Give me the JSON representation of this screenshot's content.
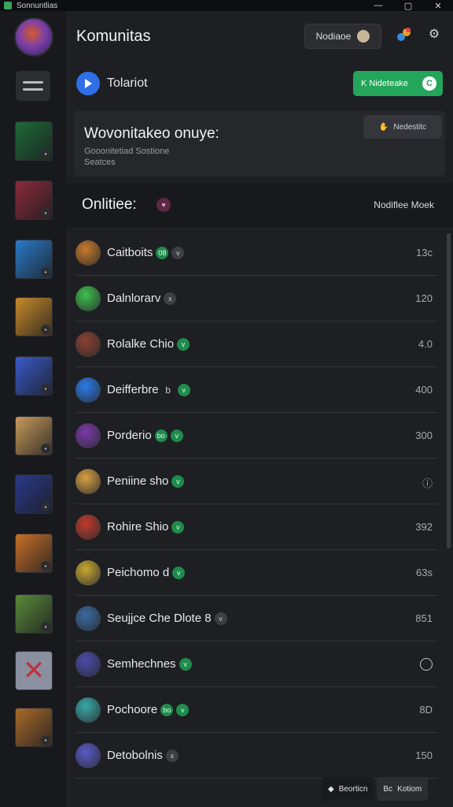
{
  "window": {
    "title": "Sonnuntlias",
    "controls": [
      "—",
      "▢",
      "✕"
    ]
  },
  "header": {
    "title": "Komunitas",
    "button_label": "Nodiaoe",
    "gear": "⚙"
  },
  "toolbar": {
    "label": "Tolariot",
    "green_button_label": "K Nideteake",
    "green_button_icon": "C"
  },
  "banner": {
    "title": "Wovonitakeo onuye:",
    "subtitle_1": "Gooonitetiad Sostione",
    "subtitle_2": "Seatces",
    "button_label": "Nedestitc"
  },
  "section": {
    "title": "Onlitiee:",
    "badge": "♥",
    "right_label": "Nodiflee Moek"
  },
  "rows": [
    {
      "name": "Caitboits",
      "chips": [
        {
          "t": "08",
          "c": "green"
        },
        {
          "t": "v",
          "c": "gray"
        }
      ],
      "value": "13c",
      "avatar": "#c87a2a"
    },
    {
      "name": "Dalnlorarv",
      "chips": [
        {
          "t": "x",
          "c": "gray"
        }
      ],
      "value": "120",
      "avatar": "#3ec04c"
    },
    {
      "name": "Rolalke Chio",
      "chips": [
        {
          "t": "v",
          "c": "green"
        }
      ],
      "value": "4.0",
      "avatar": "#8a4030"
    },
    {
      "name": "Deifferbre",
      "chips": [
        {
          "t": "b",
          "c": "plain"
        },
        {
          "t": "v",
          "c": "green"
        }
      ],
      "value": "400",
      "avatar": "#2a7ae8"
    },
    {
      "name": "Porderio",
      "chips": [
        {
          "t": "bo",
          "c": "green"
        },
        {
          "t": "v",
          "c": "green"
        }
      ],
      "value": "300",
      "avatar": "#7a3aa8"
    },
    {
      "name": "Peniine sho",
      "chips": [
        {
          "t": "v",
          "c": "green"
        }
      ],
      "value": "ⓘ",
      "avatar": "#d8a040"
    },
    {
      "name": "Rohire Shio",
      "chips": [
        {
          "t": "v",
          "c": "green"
        }
      ],
      "value": "392",
      "avatar": "#c03a2a"
    },
    {
      "name": "Peichomo d",
      "chips": [
        {
          "t": "v",
          "c": "green"
        }
      ],
      "value": "63s",
      "avatar": "#c8a830"
    },
    {
      "name": "Seujjce Che Dlote 8",
      "chips": [
        {
          "t": "v",
          "c": "gray"
        }
      ],
      "value": "851",
      "avatar": "#3a6aa0"
    },
    {
      "name": "Semhechnes",
      "chips": [
        {
          "t": "v",
          "c": "green"
        }
      ],
      "value": "",
      "avatar": "#4a4aa8"
    },
    {
      "name": "Pochoore",
      "chips": [
        {
          "t": "bo",
          "c": "green"
        },
        {
          "t": "v",
          "c": "green"
        }
      ],
      "value": "8D",
      "avatar": "#3aa8a8"
    },
    {
      "name": "Detobolnis",
      "chips": [
        {
          "t": "x",
          "c": "gray"
        }
      ],
      "value": "150",
      "avatar": "#5a5ac8"
    }
  ],
  "bottom_actions": {
    "first": "Beorticn",
    "second": "Kotiom",
    "second_prefix": "Bc"
  },
  "rail_colors": [
    "#1e6a38",
    "#8a2a3a",
    "#2a7ac8",
    "#c88a2a",
    "#3a5ac8",
    "#c89a5a",
    "#2a3a8a",
    "#c8702a",
    "#5a8a3a",
    "#8a90a0",
    "#a86a2a"
  ]
}
